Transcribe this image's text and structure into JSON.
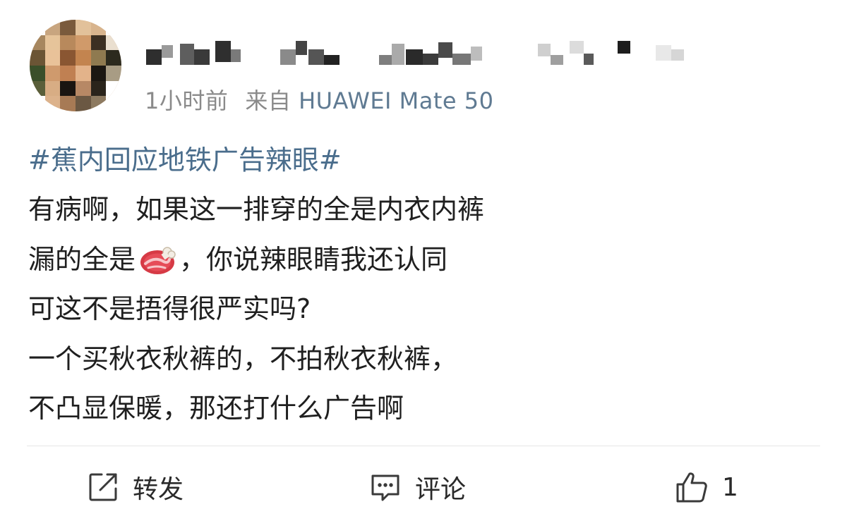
{
  "post": {
    "timestamp": "1小时前",
    "source_prefix": "来自",
    "source_device": "HUAWEI Mate 50",
    "hashtag": "#蕉内回应地铁广告辣眼#",
    "lines": [
      "有病啊，如果这一排穿的全是内衣内裤",
      "漏的全是",
      "，你说辣眼睛我还认同",
      "可这不是捂得很严实吗?",
      "一个买秋衣秋裤的，不拍秋衣秋裤，",
      "不凸显保暖，那还打什么广告啊"
    ],
    "emoji": "meat-on-bone-icon"
  },
  "actions": {
    "repost_label": "转发",
    "comment_label": "评论",
    "like_count": "1"
  },
  "colors": {
    "hashtag": "#4a6d8c",
    "source": "#5f7a92",
    "meta_gray": "#8a8a8a",
    "text": "#1f1f1f"
  }
}
